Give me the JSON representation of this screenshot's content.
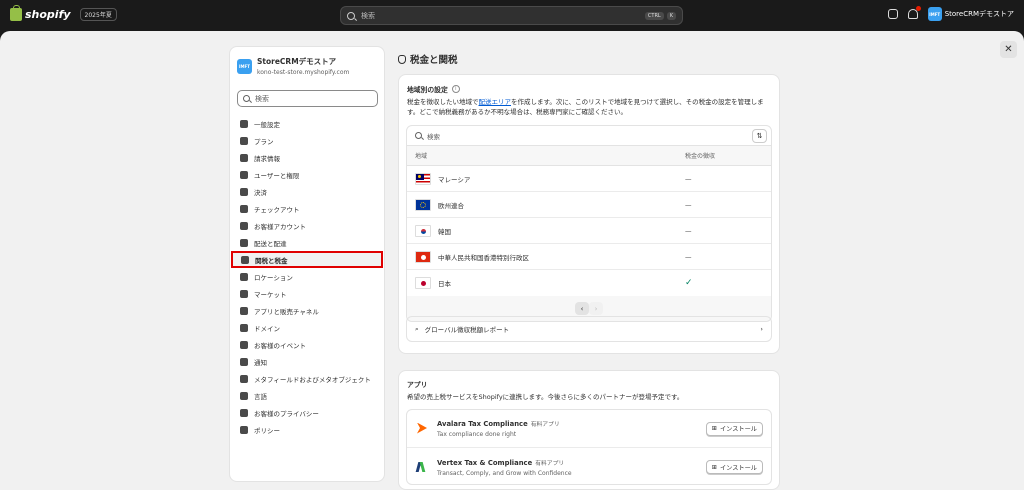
{
  "topbar": {
    "brand": "shopify",
    "edition": "2025年夏",
    "search_placeholder": "検索",
    "kbd1": "CTRL",
    "kbd2": "K",
    "store_name": "StoreCRMデモストア",
    "avatar_text": "IMFT"
  },
  "sidebar": {
    "store_name": "StoreCRMデモストア",
    "store_url": "kono-test-store.myshopify.com",
    "search_placeholder": "検索",
    "items": [
      {
        "label": "一般設定"
      },
      {
        "label": "プラン"
      },
      {
        "label": "請求情報"
      },
      {
        "label": "ユーザーと権限"
      },
      {
        "label": "決済"
      },
      {
        "label": "チェックアウト"
      },
      {
        "label": "お客様アカウント"
      },
      {
        "label": "配送と配達"
      },
      {
        "label": "関税と税金"
      },
      {
        "label": "ロケーション"
      },
      {
        "label": "マーケット"
      },
      {
        "label": "アプリと販売チャネル"
      },
      {
        "label": "ドメイン"
      },
      {
        "label": "お客様のイベント"
      },
      {
        "label": "通知"
      },
      {
        "label": "メタフィールドおよびメタオブジェクト"
      },
      {
        "label": "言語"
      },
      {
        "label": "お客様のプライバシー"
      },
      {
        "label": "ポリシー"
      }
    ]
  },
  "main": {
    "title": "税金と関税",
    "regions": {
      "title": "地域別の設定",
      "desc_pre": "税金を徴収したい地域で",
      "desc_link": "配送エリア",
      "desc_post": "を作成します。次に、このリストで地域を見つけて選択し、その税金の設定を管理します。どこで納税義務があるか不明な場合は、税務専門家にご確認ください。",
      "search_placeholder": "検索",
      "col_region": "地域",
      "col_collect": "税金の徴収",
      "rows": [
        {
          "name": "マレーシア",
          "status": "—"
        },
        {
          "name": "欧州連合",
          "status": "—"
        },
        {
          "name": "韓国",
          "status": "—"
        },
        {
          "name": "中華人民共和国香港特別行政区",
          "status": "—"
        },
        {
          "name": "日本",
          "status": "✓"
        }
      ],
      "report_label": "グローバル徴収税額レポート"
    },
    "apps": {
      "title": "アプリ",
      "desc": "希望の売上税サービスをShopifyに連携します。今後さらに多くのパートナーが登場予定です。",
      "items": [
        {
          "name": "Avalara Tax Compliance",
          "badge": "有料アプリ",
          "sub": "Tax compliance done right",
          "button": "インストール"
        },
        {
          "name": "Vertex Tax & Compliance",
          "badge": "有料アプリ",
          "sub": "Transact, Comply, and Grow with Confidence",
          "button": "インストール"
        }
      ]
    }
  },
  "colors": {
    "accent_link": "#005bd3",
    "highlight": "#e00000",
    "check": "#008060"
  }
}
